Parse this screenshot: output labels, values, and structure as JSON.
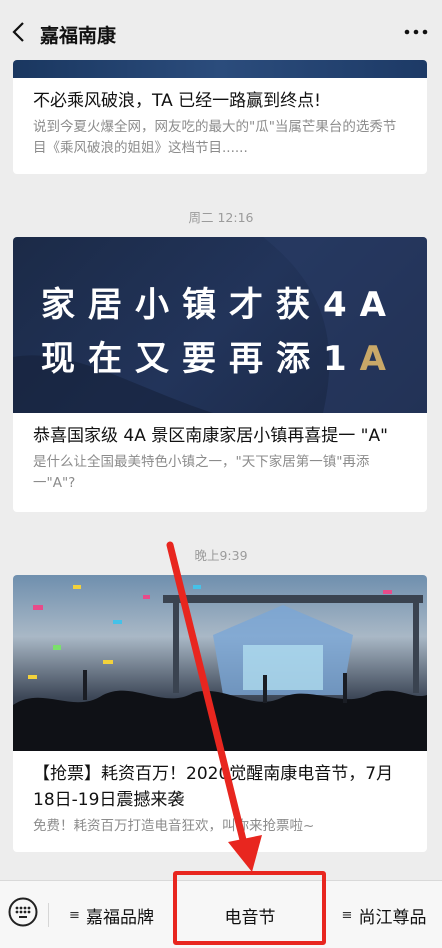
{
  "header": {
    "title": "嘉福南康"
  },
  "articles": [
    {
      "title": "不必乘风破浪，TA 已经一路赢到终点!",
      "desc": "说到今夏火爆全网，网友吃的最大的\"瓜\"当属芒果台的选秀节目《乘风破浪的姐姐》这档节目......"
    },
    {
      "time": "周二 12:16",
      "banner_line1": "家居小镇才获4A",
      "banner_line2a": "现在又要再添1",
      "banner_line2b": "A",
      "title": "恭喜国家级 4A 景区南康家居小镇再喜提一 \"A\"",
      "desc": "是什么让全国最美特色小镇之一，\"天下家居第一镇\"再添一\"A\"?"
    },
    {
      "time": "晚上9:39",
      "title": "【抢票】耗资百万！2020觉醒南康电音节，7月18日-19日震撼来袭",
      "desc": "免费！耗资百万打造电音狂欢，叫你来抢票啦~"
    }
  ],
  "tabbar": {
    "items": [
      {
        "label": "嘉福品牌",
        "bars": "≡"
      },
      {
        "label": "电音节"
      },
      {
        "label": "尚江尊品",
        "bars": "≡"
      }
    ]
  },
  "colors": {
    "highlight": "#e8261f",
    "gold": "#c9a868"
  },
  "icons": [
    "back-arrow-icon",
    "more-dots-icon",
    "keyboard-icon",
    "menu-bars-icon"
  ]
}
